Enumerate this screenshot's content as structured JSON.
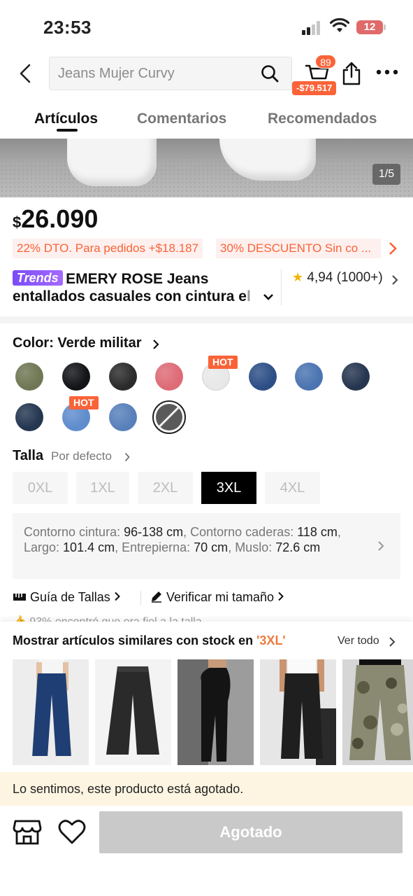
{
  "status_bar": {
    "time": "23:53",
    "battery": "12"
  },
  "header": {
    "search_placeholder": "Jeans Mujer Curvy",
    "cart_count": "89",
    "cart_price": "-$79.517"
  },
  "tabs": [
    {
      "label": "Artículos",
      "active": true
    },
    {
      "label": "Comentarios",
      "active": false
    },
    {
      "label": "Recomendados",
      "active": false
    }
  ],
  "gallery": {
    "pager": "1/5"
  },
  "product": {
    "currency": "$",
    "price": "26.090",
    "promos": [
      "22% DTO. Para pedidos +$18.187",
      "30% DESCUENTO Sin co ..."
    ],
    "badge": "Trends",
    "title_line1": "EMERY ROSE Jeans",
    "title_line2": "entallados casuales con cintura e",
    "title_line2_fade": "l",
    "rating": "4,94",
    "reviews": "(1000+)"
  },
  "color": {
    "label": "Color: Verde militar",
    "hot_label": "HOT",
    "swatches": [
      {
        "name": "verde-militar",
        "color": "#6f7754"
      },
      {
        "name": "negro",
        "color": "#121417"
      },
      {
        "name": "negro-lavado",
        "color": "#2b2b2b"
      },
      {
        "name": "rosa",
        "color": "#dd6b76"
      },
      {
        "name": "blanco",
        "color": "#e8e8e8"
      },
      {
        "name": "azul-medio",
        "color": "#2d4f86"
      },
      {
        "name": "azul-claro",
        "color": "#4b74b1"
      },
      {
        "name": "azul-oscuro",
        "color": "#263550"
      },
      {
        "name": "azul-marino",
        "color": "#243650"
      },
      {
        "name": "azul-celeste",
        "color": "#5f8ccd"
      },
      {
        "name": "azul-lavado",
        "color": "#5880ba"
      },
      {
        "name": "gris-agotado",
        "color": "#5a5a5a"
      }
    ]
  },
  "size": {
    "label": "Talla",
    "default": "Por defecto",
    "options": [
      "0XL",
      "1XL",
      "2XL",
      "3XL",
      "4XL"
    ],
    "selected": "3XL",
    "measure": {
      "waist_label": "Contorno cintura: ",
      "waist": "96-138 cm",
      "hips_label": ", Contorno caderas: ",
      "hips": "118 cm",
      "length_label": ", Largo: ",
      "length": "101.4 cm",
      "inseam_label": ", Entrepierna: ",
      "inseam": "70 cm",
      "thigh_label": ", Muslo: ",
      "thigh": "72.6 cm"
    },
    "guide": "Guía de Tallas",
    "verify": "Verificar mi tamaño",
    "fit": "93% encontró que era fiel a la talla"
  },
  "similar": {
    "title": "Mostrar artículos similares con stock en ",
    "size": "'3XL'",
    "see_all": "Ver todo"
  },
  "notice": "Lo sentimos, este producto está agotado.",
  "bottom": {
    "sold_out": "Agotado"
  }
}
